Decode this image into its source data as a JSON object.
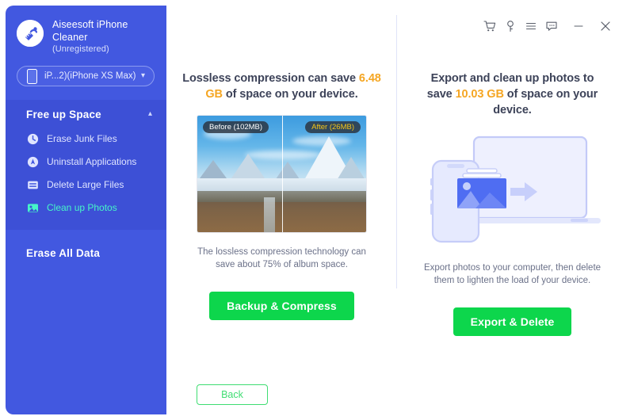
{
  "app": {
    "name": "Aiseesoft iPhone Cleaner",
    "name_line1": "Aiseesoft iPhone",
    "name_line2": "Cleaner",
    "registration": "(Unregistered)",
    "logo_icon": "broom-circle-icon"
  },
  "sidebar": {
    "device": {
      "label": "iP...2)(iPhone XS Max)",
      "phone_icon": "phone-icon",
      "caret_icon": "chevron-down-icon"
    },
    "group": {
      "title": "Free up Space",
      "caret_icon": "chevron-up-icon",
      "items": [
        {
          "label": "Erase Junk Files",
          "icon": "clock-icon",
          "active": false
        },
        {
          "label": "Uninstall Applications",
          "icon": "app-rocket-icon",
          "active": false
        },
        {
          "label": "Delete Large Files",
          "icon": "file-lines-icon",
          "active": false
        },
        {
          "label": "Clean up Photos",
          "icon": "photo-icon",
          "active": true
        }
      ]
    },
    "section": {
      "title": "Erase All Data"
    }
  },
  "titlebar": {
    "buttons": [
      {
        "name": "cart-icon",
        "label": "cart"
      },
      {
        "name": "key-icon",
        "label": "key"
      },
      {
        "name": "menu-icon",
        "label": "menu"
      },
      {
        "name": "feedback-icon",
        "label": "feedback"
      },
      {
        "name": "minimize-icon",
        "label": "minimize"
      },
      {
        "name": "close-icon",
        "label": "close"
      }
    ]
  },
  "panels": {
    "left": {
      "headline_pre": "Lossless compression can save",
      "headline_value": "6.48 GB",
      "headline_post": "of space on your device.",
      "image": {
        "before_badge": "Before (102MB)",
        "after_badge": "After (26MB)",
        "alt": "mountain-landscape-before-after"
      },
      "caption": "The lossless compression technology can save about 75% of album space.",
      "cta": "Backup & Compress"
    },
    "right": {
      "headline_pre": "Export and clean up photos to save",
      "headline_value": "10.03 GB",
      "headline_post": "of space on your device.",
      "illustration": "phone-to-laptop-photo-transfer",
      "caption": "Export photos to your computer, then delete them to lighten the load of your device.",
      "cta": "Export & Delete"
    }
  },
  "footer": {
    "back": "Back"
  },
  "colors": {
    "sidebar_bg": "#4258e0",
    "sidebar_group_bg": "#3d50d6",
    "accent_green": "#0dd64c",
    "accent_orange": "#f5a623",
    "active_item": "#46f5c8",
    "back_border": "#3fdd72"
  }
}
